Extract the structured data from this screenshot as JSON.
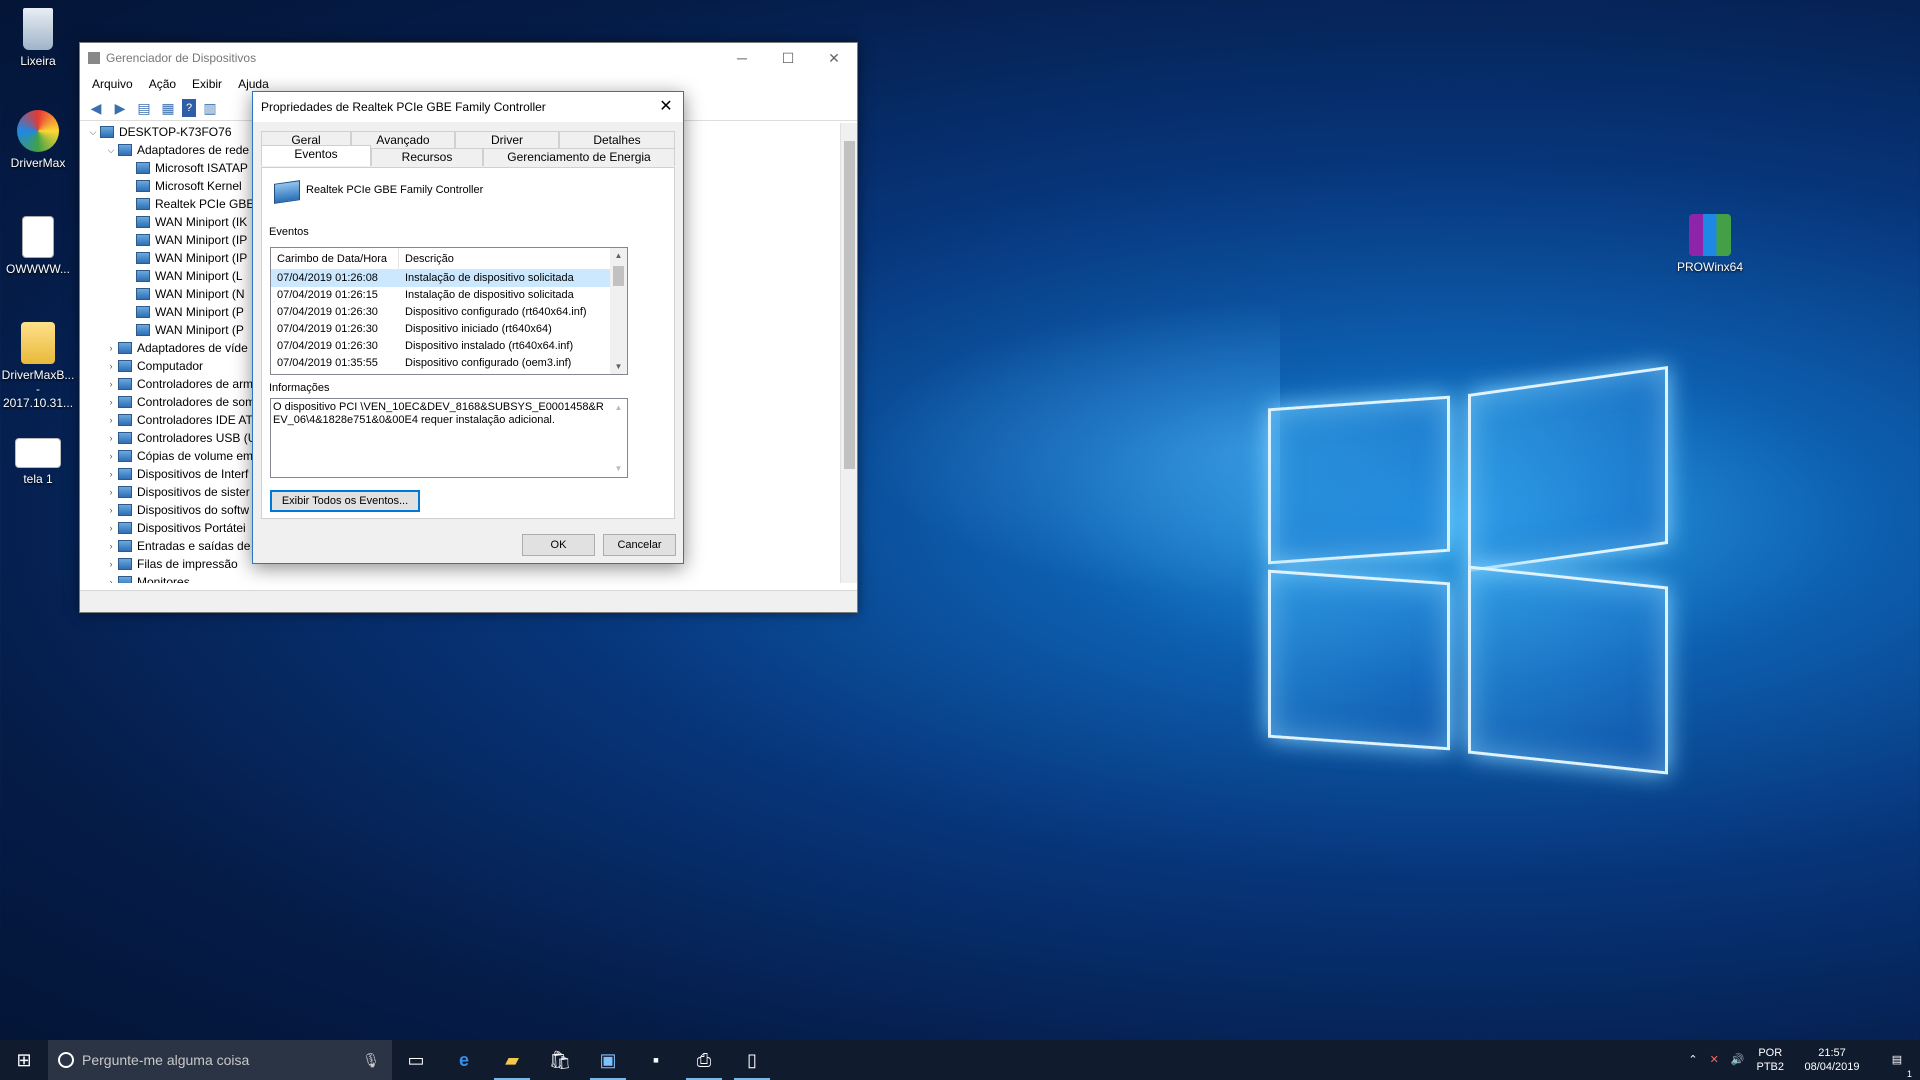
{
  "desktop": {
    "icons": [
      {
        "label": "Lixeira",
        "icon": "recycle-bin-icon"
      },
      {
        "label": "DriverMax",
        "icon": "drivermax-icon"
      },
      {
        "label": "OWWWW...",
        "icon": "text-file-icon"
      },
      {
        "label": "DriverMaxB... - 2017.10.31...",
        "icon": "folder-zip-icon"
      },
      {
        "label": "tela 1",
        "icon": "image-file-icon"
      },
      {
        "label": "PROWinx64",
        "icon": "winrar-archive-icon"
      }
    ]
  },
  "device_manager": {
    "title": "Gerenciador de Dispositivos",
    "menu": [
      "Arquivo",
      "Ação",
      "Exibir",
      "Ajuda"
    ],
    "tree": [
      {
        "label": "DESKTOP-K73FO76",
        "level": 0,
        "expander": "open"
      },
      {
        "label": "Adaptadores de rede",
        "level": 1,
        "expander": "open"
      },
      {
        "label": "Microsoft ISATAP",
        "level": 2,
        "expander": ""
      },
      {
        "label": "Microsoft Kernel",
        "level": 2,
        "expander": ""
      },
      {
        "label": "Realtek PCIe GBE",
        "level": 2,
        "expander": ""
      },
      {
        "label": "WAN Miniport (IK",
        "level": 2,
        "expander": ""
      },
      {
        "label": "WAN Miniport (IP",
        "level": 2,
        "expander": ""
      },
      {
        "label": "WAN Miniport (IP",
        "level": 2,
        "expander": ""
      },
      {
        "label": "WAN Miniport (L",
        "level": 2,
        "expander": ""
      },
      {
        "label": "WAN Miniport (N",
        "level": 2,
        "expander": ""
      },
      {
        "label": "WAN Miniport (P",
        "level": 2,
        "expander": ""
      },
      {
        "label": "WAN Miniport (P",
        "level": 2,
        "expander": ""
      },
      {
        "label": "Adaptadores de víde",
        "level": 1,
        "expander": "closed"
      },
      {
        "label": "Computador",
        "level": 1,
        "expander": "closed"
      },
      {
        "label": "Controladores de arm",
        "level": 1,
        "expander": "closed"
      },
      {
        "label": "Controladores de som",
        "level": 1,
        "expander": "closed"
      },
      {
        "label": "Controladores IDE AT",
        "level": 1,
        "expander": "closed"
      },
      {
        "label": "Controladores USB (U",
        "level": 1,
        "expander": "closed"
      },
      {
        "label": "Cópias de volume em",
        "level": 1,
        "expander": "closed"
      },
      {
        "label": "Dispositivos de Interf",
        "level": 1,
        "expander": "closed"
      },
      {
        "label": "Dispositivos de sister",
        "level": 1,
        "expander": "closed"
      },
      {
        "label": "Dispositivos do softw",
        "level": 1,
        "expander": "closed"
      },
      {
        "label": "Dispositivos Portátei",
        "level": 1,
        "expander": "closed"
      },
      {
        "label": "Entradas e saídas de",
        "level": 1,
        "expander": "closed"
      },
      {
        "label": "Filas de impressão",
        "level": 1,
        "expander": "closed"
      },
      {
        "label": "Monitores",
        "level": 1,
        "expander": "closed"
      }
    ]
  },
  "dialog": {
    "title": "Propriedades de Realtek PCIe GBE Family Controller",
    "tabs_back": [
      "Geral",
      "Avançado",
      "Driver",
      "Detalhes"
    ],
    "tabs_front": [
      "Eventos",
      "Recursos",
      "Gerenciamento de Energia"
    ],
    "device_name": "Realtek PCIe GBE Family Controller",
    "events_label": "Eventos",
    "columns": [
      "Carimbo de Data/Hora",
      "Descrição"
    ],
    "events": [
      {
        "time": "07/04/2019 01:26:08",
        "desc": "Instalação de dispositivo solicitada"
      },
      {
        "time": "07/04/2019 01:26:15",
        "desc": "Instalação de dispositivo solicitada"
      },
      {
        "time": "07/04/2019 01:26:30",
        "desc": "Dispositivo configurado (rt640x64.inf)"
      },
      {
        "time": "07/04/2019 01:26:30",
        "desc": "Dispositivo iniciado (rt640x64)"
      },
      {
        "time": "07/04/2019 01:26:30",
        "desc": "Dispositivo instalado (rt640x64.inf)"
      },
      {
        "time": "07/04/2019 01:35:55",
        "desc": "Dispositivo configurado (oem3.inf)"
      }
    ],
    "info_label": "Informações",
    "info_text": "O dispositivo PCI \\VEN_10EC&DEV_8168&SUBSYS_E0001458&REV_06\\4&1828e751&0&00E4 requer instalação adicional.",
    "view_all_button": "Exibir Todos os Eventos...",
    "ok_button": "OK",
    "cancel_button": "Cancelar"
  },
  "taskbar": {
    "search_placeholder": "Pergunte-me alguma coisa",
    "lang_top": "POR",
    "lang_bottom": "PTB2",
    "time": "21:57",
    "date": "08/04/2019",
    "notification_count": "1"
  }
}
